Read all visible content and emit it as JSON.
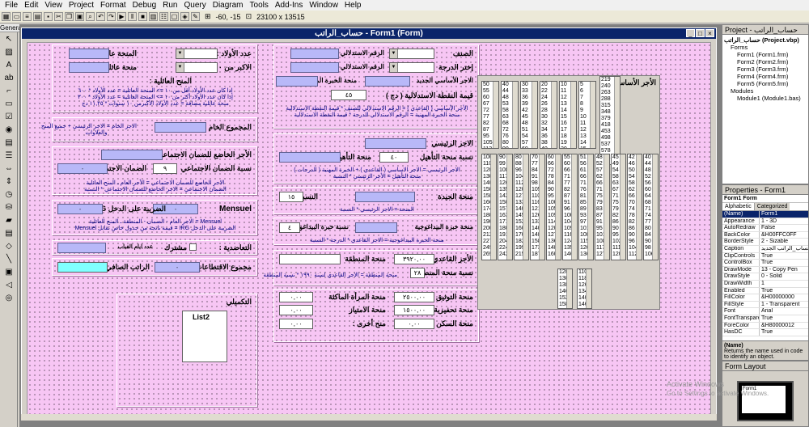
{
  "menu": [
    "File",
    "Edit",
    "View",
    "Project",
    "Format",
    "Debug",
    "Run",
    "Query",
    "Diagram",
    "Tools",
    "Add-Ins",
    "Window",
    "Help"
  ],
  "toolbar": {
    "coords": "-60, -15",
    "size": "23100 x 13515"
  },
  "toolbox": {
    "title": "General"
  },
  "form_window": {
    "title": "حساب_الراتب - Form1 (Form)"
  },
  "sec1": {
    "l_class": "الصنف",
    "l_seq_class": "الرقم الاستدلالي للصنف",
    "l_grade": "إختر الدرجة",
    "l_seq_grade": "الرقم الاستدلالي للدرجة",
    "l_base_new": "الاجر الأساسي الجديد",
    "l_exp_bonus": "منحة الخبرة المهنية",
    "l_index_value": "قيمة النقطة الاستدلالية ( دج )",
    "index_value": "٤٥",
    "note1": "الأجر الأساسي ( القاعدي ) = الرقم الاستدلالي للصنف * قيمة النقطة الاستدلالية",
    "note2": "منحة الخبرة المهنية = الرقم الاستدلالي للدرجة * قيمة النقطة الاستدلالية"
  },
  "sec2": {
    "l_main_wage": "الاجر الرئيسي",
    "l_qual_rate": "نسبة منحة التأهيل",
    "qual_rate": "٤٠",
    "l_qual": "منحة التأهيل",
    "note1": "الاجر الرئيسي = الاجر الاساسي ( القاعدي ) + الخبرة المهنية ( الدرجات )",
    "note2": "منحة التأهيل = الأجر الرئيسي * النسبة"
  },
  "sec3": {
    "l_rate": "النسبة",
    "rate": "١٥",
    "l_doc": "منحة الجيدة",
    "note": "المنحة = الاجر الرئيسي * النسبة"
  },
  "sec4": {
    "l_rate": "نسبة خبرة البيداغوجية",
    "rate": "٤",
    "l_ped": "منحة خبرة البيداغوجية",
    "note": "منحة الخبرة البيداغوجية = الاجر القاعدي * الدرجة * النسبة"
  },
  "sec5": {
    "l_base90": "الأجر القاعدي ٩٠:",
    "base90": "٣٩٢٠,٠٠",
    "l_region": "منحة المنطقة",
    "l_region_rate": "نسبة منحة المنطقة",
    "region_rate": "٢٨",
    "note": "منحة المنطقة = الاجر القاعدي لسنة ١٩٩٠ * نسبة المنطقة"
  },
  "sec6": {
    "l_doc_bonus": "منحة التوثيق :",
    "doc_bonus": "٢٥٠٠,٠٠",
    "l_woman": "منحة المرأة الماكثة",
    "woman": "٠,٠٠",
    "l_incent": "منحة تحفيزية :",
    "incent": "١٥٠٠,٠٠",
    "l_excel": "منحة الامتياز",
    "excel": "٠,٠٠",
    "l_other": "منح أخرى :",
    "other": "٠,٠٠",
    "l_housing": "منحة السكن :",
    "housing": "٠,٠٠"
  },
  "lists": {
    "title": "الأجر الأساسي",
    "c1a": [
      "50",
      "55",
      "60",
      "67",
      "72",
      "77",
      "82",
      "87",
      "95",
      "105",
      "113",
      "124",
      "134"
    ],
    "c2a": [
      "40",
      "44",
      "48",
      "53",
      "58",
      "63",
      "68",
      "72",
      "76",
      "80",
      "90",
      "100",
      "107"
    ],
    "c3a": [
      "30",
      "33",
      "36",
      "39",
      "42",
      "45",
      "48",
      "51",
      "54",
      "57",
      "60",
      "63",
      "66"
    ],
    "c4a": [
      "20",
      "22",
      "24",
      "26",
      "28",
      "30",
      "32",
      "34",
      "36",
      "38",
      "40",
      "42",
      "44"
    ],
    "c5a": [
      "10",
      "11",
      "12",
      "13",
      "14",
      "15",
      "16",
      "17",
      "18",
      "19",
      "20",
      "21",
      "22"
    ],
    "c6a": [
      "5",
      "6",
      "7",
      "8",
      "9",
      "10",
      "11",
      "12",
      "13",
      "14",
      "15",
      "16",
      "17"
    ],
    "big": [
      "219",
      "240",
      "263",
      "288",
      "315",
      "348",
      "379",
      "418",
      "453",
      "498",
      "537",
      "578",
      "621"
    ],
    "c1b": [
      "100",
      "110",
      "120",
      "130",
      "140",
      "150",
      "158",
      "166",
      "174",
      "180",
      "190",
      "200",
      "212",
      "227",
      "249",
      "269"
    ],
    "c2b": [
      "90",
      "99",
      "108",
      "117",
      "126",
      "135",
      "142",
      "150",
      "157",
      "163",
      "171",
      "180",
      "191",
      "204",
      "224",
      "242"
    ],
    "c3b": [
      "80",
      "88",
      "96",
      "104",
      "112",
      "120",
      "127",
      "133",
      "140",
      "145",
      "152",
      "160",
      "170",
      "182",
      "199",
      "215"
    ],
    "c4b": [
      "70",
      "77",
      "84",
      "91",
      "98",
      "105",
      "110",
      "116",
      "121",
      "126",
      "133",
      "140",
      "148",
      "158",
      "173",
      "187"
    ],
    "c5b": [
      "60",
      "66",
      "72",
      "78",
      "84",
      "90",
      "95",
      "100",
      "105",
      "109",
      "114",
      "120",
      "127",
      "136",
      "148",
      "160"
    ],
    "c6b": [
      "55",
      "60",
      "66",
      "71",
      "77",
      "82",
      "87",
      "91",
      "96",
      "100",
      "104",
      "109",
      "116",
      "124",
      "135",
      "146"
    ],
    "c7b": [
      "51",
      "56",
      "61",
      "66",
      "71",
      "76",
      "81",
      "85",
      "89",
      "93",
      "97",
      "101",
      "108",
      "115",
      "126",
      "136"
    ],
    "c8b": [
      "48",
      "52",
      "57",
      "62",
      "66",
      "71",
      "75",
      "79",
      "83",
      "87",
      "91",
      "95",
      "101",
      "108",
      "117",
      "127"
    ],
    "c9b": [
      "45",
      "49",
      "54",
      "58",
      "63",
      "67",
      "71",
      "75",
      "79",
      "82",
      "86",
      "90",
      "95",
      "102",
      "111",
      "120"
    ],
    "c10b": [
      "42",
      "46",
      "50",
      "54",
      "58",
      "62",
      "66",
      "70",
      "74",
      "78",
      "82",
      "86",
      "90",
      "96",
      "104",
      "112"
    ],
    "c11b": [
      "40",
      "44",
      "48",
      "52",
      "56",
      "60",
      "64",
      "68",
      "71",
      "74",
      "77",
      "80",
      "84",
      "90",
      "98",
      "106"
    ],
    "c1c": [
      "120",
      "130",
      "138",
      "146",
      "152",
      "158",
      "166",
      "174",
      "182",
      "190",
      "198",
      "206",
      "214",
      "222",
      "230",
      "240",
      "251",
      "262",
      "271",
      "283",
      "296",
      "309",
      "322"
    ],
    "c2c": [
      "110",
      "118",
      "126",
      "134",
      "140",
      "146",
      "152",
      "158",
      "164",
      "170",
      "176",
      "182",
      "188",
      "194",
      "200",
      "206",
      "212",
      "218",
      "224",
      "230",
      "236",
      "242",
      "248"
    ]
  },
  "left1": {
    "l_children": "عدد الأولاد :",
    "l_family": "المنحة عائلية",
    "l_over10": "الاكبر من ١٠",
    "l_extra": "منحة عائلية مضافة",
    "l_sum": "المنح العائلية :",
    "note1": "إذا كان عدد الأولاد أقل من ١٠ => المنحة العائلية = عدد الأولاد * ٦٠٠",
    "note2": "إذا كان عدد الأولاد أكثر من ١٠ => المنحة العائلية = عدد الأولاد * ٣٠٠",
    "note3": "منحة عائلية مضافة = عدد الأولاد الأكبرمن ١٠ سنوات * ١١,٢٥ دج"
  },
  "gross": {
    "label": "المجموع الخام :",
    "note1": "الاجر الخام = الاجر الرئيسي + جميع المنح",
    "note2": "والعلاوات"
  },
  "social": {
    "l_subject": "الأجر الخاضع للضمان الاجتماعي :",
    "l_rate": "نسبة الضمان الاجتماعي",
    "rate": "٩",
    "l_social": "الضمان الاجتماعي :",
    "social": "٠",
    "note1": "الاجر الخاضع للضمان الاجتماعي = الأجر العام ـ المنح العائلية",
    "note2": "الضمان الاجتماعي = الاجر الخاضع للضمان الاجتماعي * النسبة"
  },
  "irg": {
    "title": "Mensuel",
    "l_irg": "الضريبة على الدخل IRG :",
    "irg1": "٠",
    "irg2": "٠",
    "note1": "Mensuel = الاجر العام - الضمان - المنطقة ـ المنح العائلية",
    "note2": "الضريبة على الدخل IRG = قيمة ناتجة من جدول خاص تقابل Mensuel"
  },
  "mut": {
    "l_mut": "التعاضدية :",
    "l_share": "مشترك",
    "l_absent": "عدد ايام الغياب"
  },
  "net": {
    "l_deduct": "مجموع الاقتطاعات :",
    "deduct": "٠",
    "l_net": "الراتب الصافي :"
  },
  "extra": {
    "title": "التكميلي",
    "list2": "List2"
  },
  "project": {
    "title": "Project - حساب_الراتب",
    "root": "حساب_الراتب (Project.vbp)",
    "forms": "Forms",
    "formlist": [
      "Form1 (Form1.frm)",
      "Form2 (Form2.frm)",
      "Form3 (Form3.frm)",
      "Form4 (Form4.frm)",
      "Form5 (Form5.frm)"
    ],
    "modules": "Modules",
    "modlist": [
      "Module1 (Module1.bas)"
    ]
  },
  "props": {
    "title": "Properties - Form1",
    "object": "Form1  Form",
    "tab1": "Alphabetic",
    "tab2": "Categorized",
    "rows": [
      [
        "(Name)",
        "Form1"
      ],
      [
        "Appearance",
        "1 - 3D"
      ],
      [
        "AutoRedraw",
        "False"
      ],
      [
        "BackColor",
        "&H00FFC0FF"
      ],
      [
        "BorderStyle",
        "2 - Sizable"
      ],
      [
        "Caption",
        "حساب_الراتب الجديد"
      ],
      [
        "ClipControls",
        "True"
      ],
      [
        "ControlBox",
        "True"
      ],
      [
        "DrawMode",
        "13 - Copy Pen"
      ],
      [
        "DrawStyle",
        "0 - Solid"
      ],
      [
        "DrawWidth",
        "1"
      ],
      [
        "Enabled",
        "True"
      ],
      [
        "FillColor",
        "&H00000000"
      ],
      [
        "FillStyle",
        "1 - Transparent"
      ],
      [
        "Font",
        "Arial"
      ],
      [
        "FontTransparent",
        "True"
      ],
      [
        "ForeColor",
        "&H80000012"
      ],
      [
        "HasDC",
        "True"
      ]
    ],
    "desc_title": "(Name)",
    "desc": "Returns the name used in code to identify an object."
  },
  "layout": {
    "title": "Form Layout",
    "form": "Form1"
  },
  "watermark": {
    "line1": "Activate Windows",
    "line2": "Go to Settings to activate Windows."
  }
}
